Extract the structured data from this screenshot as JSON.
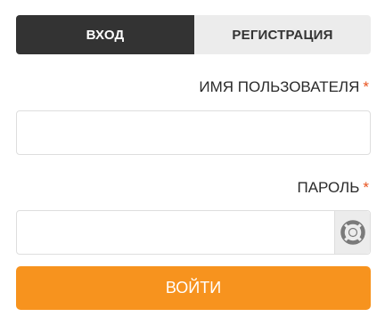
{
  "tabs": {
    "login": "ВХОД",
    "register": "РЕГИСТРАЦИЯ",
    "active": "login"
  },
  "form": {
    "username_label": "ИМЯ ПОЛЬЗОВАТЕЛЯ",
    "password_label": "ПАРОЛЬ",
    "required_mark": "*",
    "username_value": "",
    "password_value": "",
    "password_toggle_icon": "lifebuoy-icon",
    "submit_label": "ВОЙТИ"
  },
  "colors": {
    "active_tab": "#333333",
    "inactive_tab": "#ececec",
    "accent": "#f7931e",
    "required": "#e8531f"
  }
}
